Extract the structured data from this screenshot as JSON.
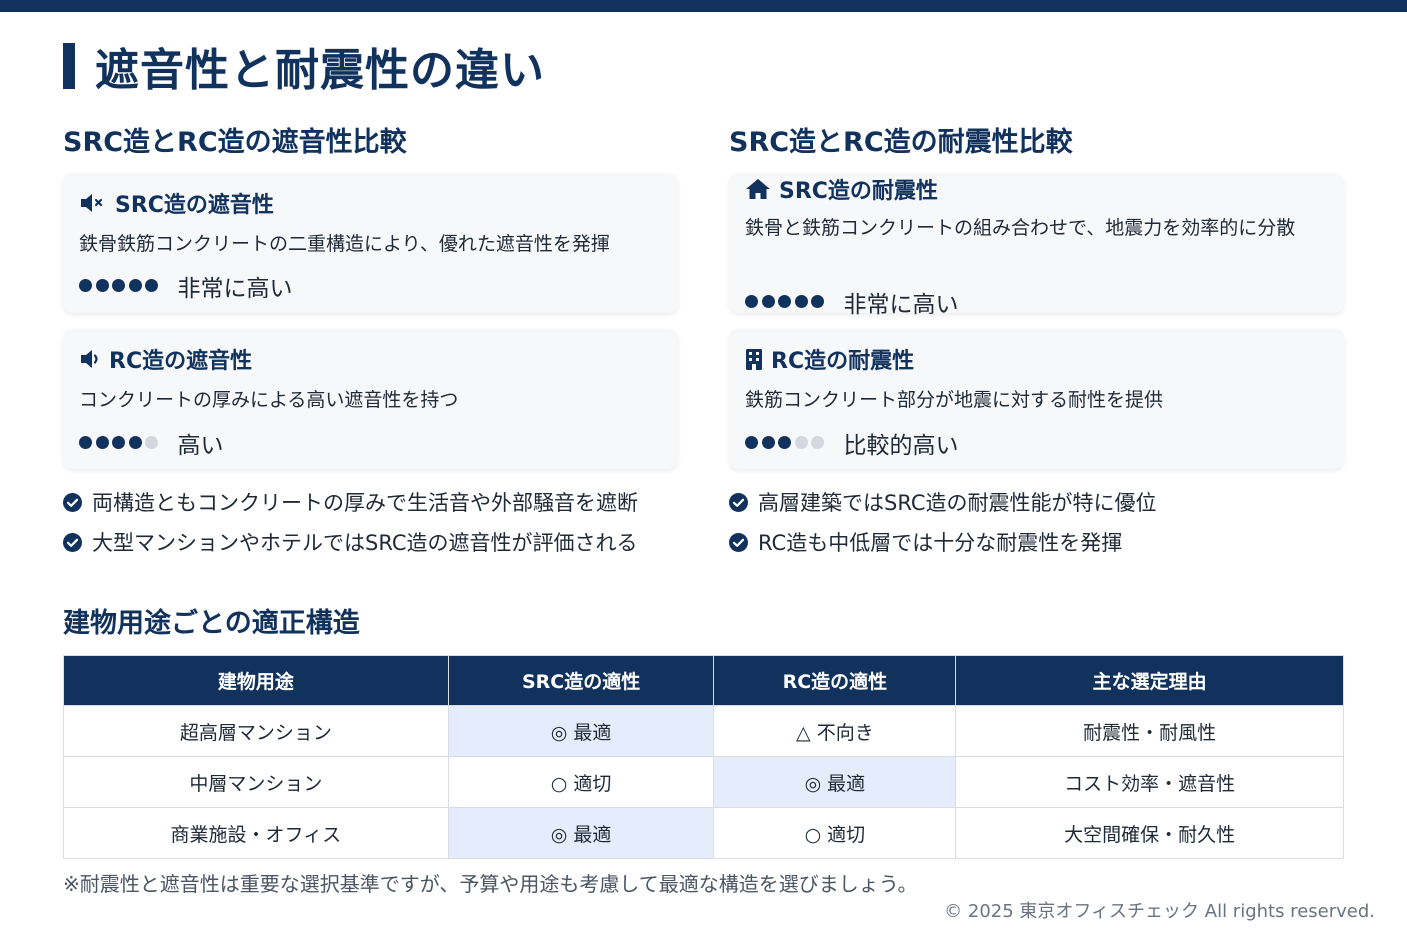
{
  "title": "遮音性と耐震性の違い",
  "left": {
    "heading": "SRC造とRC造の遮音性比較",
    "cards": [
      {
        "icon": "mute-speaker-icon",
        "title": "SRC造の遮音性",
        "desc": "鉄骨鉄筋コンクリートの二重構造により、優れた遮音性を発揮",
        "rating": 5,
        "rating_text": "非常に高い"
      },
      {
        "icon": "speaker-low-icon",
        "title": "RC造の遮音性",
        "desc": "コンクリートの厚みによる高い遮音性を持つ",
        "rating": 4,
        "rating_text": "高い"
      }
    ],
    "bullets": [
      "両構造ともコンクリートの厚みで生活音や外部騒音を遮断",
      "大型マンションやホテルではSRC造の遮音性が評価される"
    ]
  },
  "right": {
    "heading": "SRC造とRC造の耐震性比較",
    "cards": [
      {
        "icon": "house-icon",
        "title": "SRC造の耐震性",
        "desc": "鉄骨と鉄筋コンクリートの組み合わせで、地震力を効率的に分散",
        "rating": 5,
        "rating_text": "非常に高い"
      },
      {
        "icon": "building-icon",
        "title": "RC造の耐震性",
        "desc": "鉄筋コンクリート部分が地震に対する耐性を提供",
        "rating": 3,
        "rating_text": "比較的高い"
      }
    ],
    "bullets": [
      "高層建築ではSRC造の耐震性能が特に優位",
      "RC造も中低層では十分な耐震性を発揮"
    ]
  },
  "table": {
    "heading": "建物用途ごとの適正構造",
    "headers": [
      "建物用途",
      "SRC造の適性",
      "RC造の適性",
      "主な選定理由"
    ],
    "rows": [
      [
        "超高層マンション",
        "◎ 最適",
        "△ 不向き",
        "耐震性・耐風性"
      ],
      [
        "中層マンション",
        "○ 適切",
        "◎ 最適",
        "コスト効率・遮音性"
      ],
      [
        "商業施設・オフィス",
        "◎ 最適",
        "○ 適切",
        "大空間確保・耐久性"
      ]
    ]
  },
  "note": "※耐震性と遮音性は重要な選択基準ですが、予算や用途も考慮して最適な構造を選びましょう。",
  "copyright": "© 2025 東京オフィスチェック All rights reserved.",
  "colors": {
    "primary": "#12325e",
    "card_bg": "#f7f8fa",
    "highlight": "#e5edfd",
    "dot_off": "#d4d8de"
  }
}
